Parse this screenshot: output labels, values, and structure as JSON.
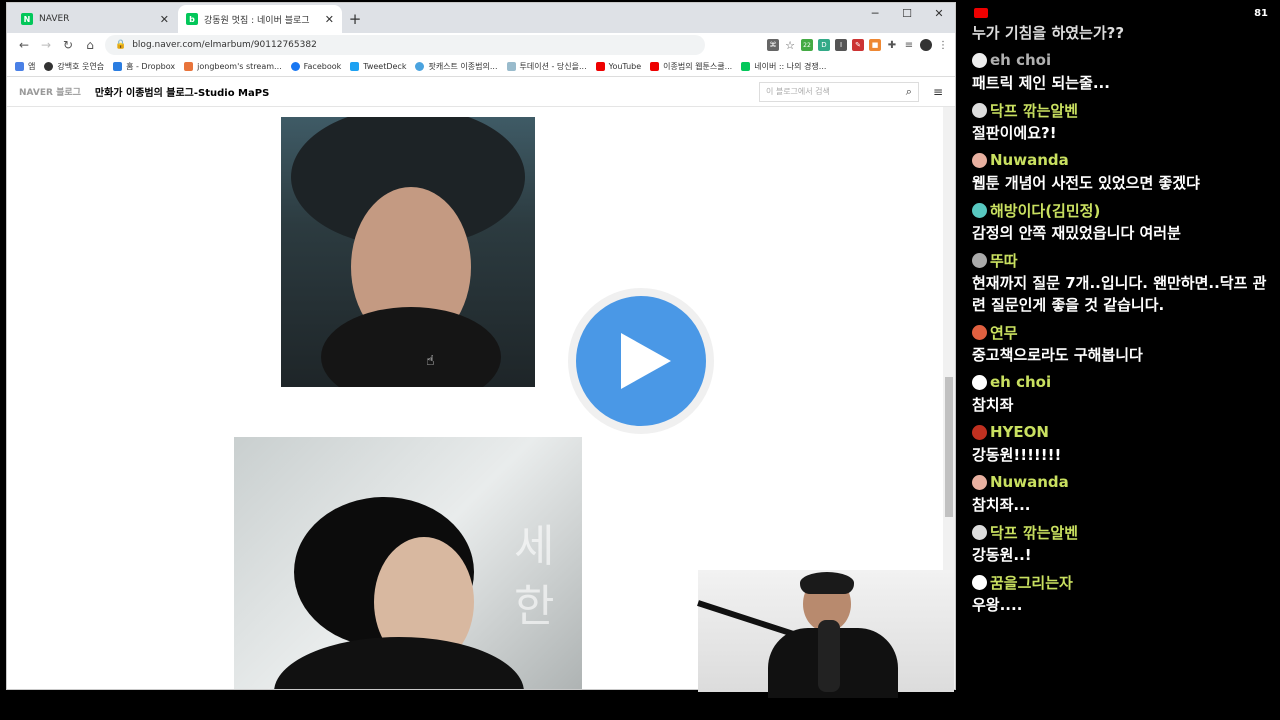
{
  "tabs": [
    {
      "label": "NAVER",
      "favicon": "naver-n"
    },
    {
      "label": "강동원 멋짐 : 네이버 블로그",
      "favicon": "naver-blog"
    }
  ],
  "url": "blog.naver.com/elmarbum/90112765382",
  "bookmarks": [
    "앱",
    "강백호 웃연습",
    "홈 - Dropbox",
    "jongbeom's stream...",
    "Facebook",
    "TweetDeck",
    "팟캐스트 이종범의...",
    "투데이션 - 당신을...",
    "YouTube",
    "이종범의 웹툰스쿨...",
    "네이버 :: 나의 경쟁..."
  ],
  "extension_badge": "22",
  "blog": {
    "brand": "NAVER 블로그",
    "title": "만화가 이종범의 블로그-Studio MaPS",
    "search_placeholder": "이 블로그에서 검색"
  },
  "overlay_text": [
    "세",
    "한"
  ],
  "chat": {
    "viewer_count": "81",
    "partial_top": "누가 기침을 하였는가??",
    "messages": [
      {
        "name": "eh choi",
        "text": "패트릭 제인 되는줄...",
        "name_style": "grey"
      },
      {
        "name": "닥프 깎는알벤",
        "text": "절판이에요?!",
        "name_style": "green"
      },
      {
        "name": "Nuwanda",
        "text": "웹툰 개념어 사전도 있었으면 좋겠댜",
        "name_style": "green"
      },
      {
        "name": "해방이다(김민정)",
        "text": "감정의 안쪽 재밌었읍니다 여러분",
        "name_style": "green"
      },
      {
        "name": "뚜따",
        "text": "현재까지 질문 7개..입니다. 왠만하면..닥프 관련 질문인게 좋을 것 같습니다.",
        "name_style": "green"
      },
      {
        "name": "연무",
        "text": "중고책으로라도 구해봅니다",
        "name_style": "green"
      },
      {
        "name": "eh choi",
        "text": "참치좌",
        "name_style": "green"
      },
      {
        "name": "HYEON",
        "text": "강동원!!!!!!!",
        "name_style": "green"
      },
      {
        "name": "Nuwanda",
        "text": "참치좌...",
        "name_style": "green"
      },
      {
        "name": "닥프 깎는알벤",
        "text": "강동원..!",
        "name_style": "green"
      },
      {
        "name": "꿈을그리는자",
        "text": "우왕....",
        "name_style": "green"
      }
    ]
  },
  "colors": {
    "play_button": "#4a98e6",
    "chat_name": "#c9e060",
    "naver_green": "#03c75a"
  }
}
